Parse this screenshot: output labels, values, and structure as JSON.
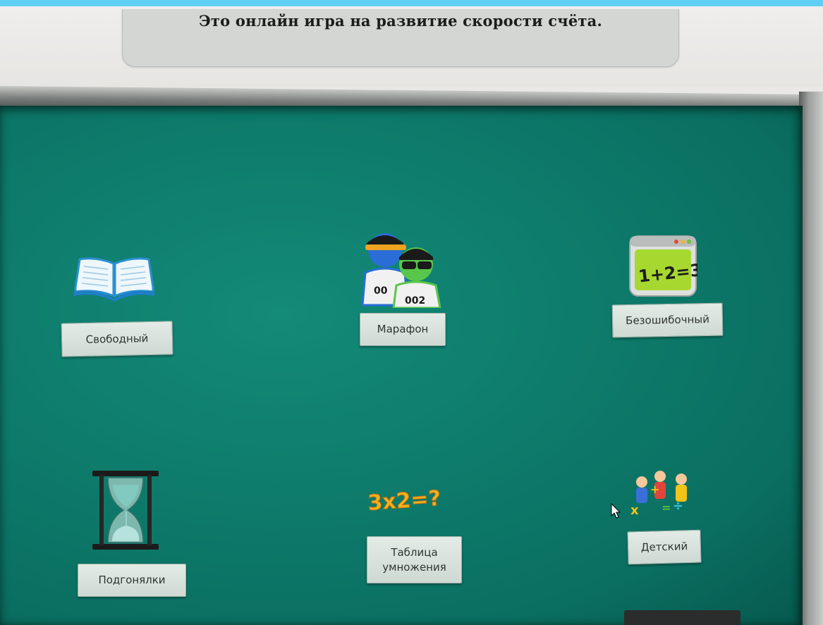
{
  "banner": {
    "text": "Это онлайн игра на развитие скорости счёта."
  },
  "modes": [
    {
      "key": "free",
      "label": "Свободный",
      "icon": "open-book-icon"
    },
    {
      "key": "marathon",
      "label": "Марафон",
      "icon": "runners-icon"
    },
    {
      "key": "errorless",
      "label": "Безошибочный",
      "icon": "chalkboard-icon",
      "icon_text": "1+2=3"
    },
    {
      "key": "chasers",
      "label": "Подгонялки",
      "icon": "hourglass-icon"
    },
    {
      "key": "multiplication",
      "label": "Таблица умножения",
      "icon": "multiplication-icon",
      "icon_text": "3x2=?"
    },
    {
      "key": "kids",
      "label": "Детский",
      "icon": "kids-icon"
    }
  ],
  "runner_numbers": [
    "00",
    "002"
  ],
  "colors": {
    "top_strip": "#5fd0f3",
    "board": "#0e7c6c",
    "button_bg": "#dfe7e2"
  }
}
